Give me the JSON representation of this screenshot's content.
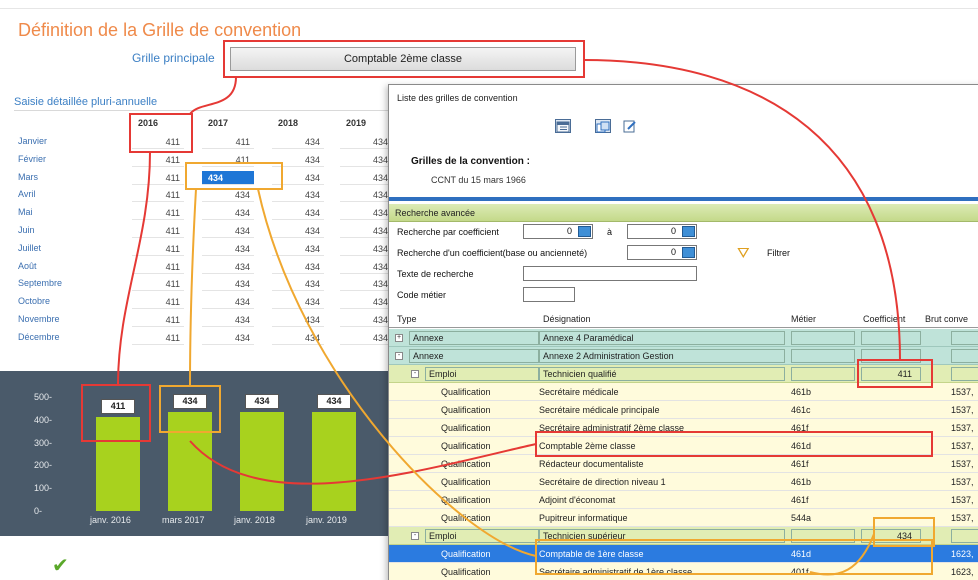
{
  "page": {
    "title": "Définition de la Grille de convention",
    "grid_label": "Grille principale",
    "grid_value": "Comptable 2ème classe",
    "saisie_label": "Saisie détaillée pluri-annuelle"
  },
  "years": [
    "2016",
    "2017",
    "2018",
    "2019"
  ],
  "months": [
    "Janvier",
    "Février",
    "Mars",
    "Avril",
    "Mai",
    "Juin",
    "Juillet",
    "Août",
    "Septembre",
    "Octobre",
    "Novembre",
    "Décembre"
  ],
  "monthly_values": [
    [
      "411",
      "411",
      "434",
      "434"
    ],
    [
      "411",
      "411",
      "434",
      "434"
    ],
    [
      "411",
      "434",
      "434",
      "434"
    ],
    [
      "411",
      "434",
      "434",
      "434"
    ],
    [
      "411",
      "434",
      "434",
      "434"
    ],
    [
      "411",
      "434",
      "434",
      "434"
    ],
    [
      "411",
      "434",
      "434",
      "434"
    ],
    [
      "411",
      "434",
      "434",
      "434"
    ],
    [
      "411",
      "434",
      "434",
      "434"
    ],
    [
      "411",
      "434",
      "434",
      "434"
    ],
    [
      "411",
      "434",
      "434",
      "434"
    ],
    [
      "411",
      "434",
      "434",
      "434"
    ]
  ],
  "selected_cell_value": "434",
  "chart_data": {
    "type": "bar",
    "categories": [
      "janv. 2016",
      "mars 2017",
      "janv. 2018",
      "janv. 2019"
    ],
    "values": [
      411,
      434,
      434,
      434
    ],
    "data_labels": [
      "411",
      "434",
      "434",
      "434"
    ],
    "y_ticks": [
      "500-",
      "400-",
      "300-",
      "200-",
      "100-",
      "0-"
    ],
    "ylim": [
      0,
      500
    ],
    "title": "",
    "xlabel": "",
    "ylabel": "",
    "bar_color": "#a8d21e",
    "background": "#4a5a6a"
  },
  "window": {
    "title": "Liste des grilles de convention",
    "toolbar_icons": [
      "calendar-icon",
      "copy-icon",
      "edit-icon"
    ],
    "grilles_title": "Grilles de la convention :",
    "grilles_value": "CCNT du 15 mars 1966",
    "search_section": "Recherche avancée",
    "search_coef_label": "Recherche par coefficient",
    "coef_from": "0",
    "a_label": "à",
    "coef_to": "0",
    "search_coef2_label": "Recherche d'un coefficient(base ou ancienneté)",
    "coef2": "0",
    "text_search_label": "Texte de recherche",
    "code_label": "Code métier",
    "filter_label": "Filtrer",
    "columns": [
      "Type",
      "Désignation",
      "Métier",
      "Coefficient",
      "Brut conve"
    ],
    "rows": [
      {
        "kind": "annexe",
        "sign": "+",
        "indent": 0,
        "type": "Annexe",
        "designation": "Annexe 4 Paramédical",
        "metier": "",
        "coef": "",
        "brut": ""
      },
      {
        "kind": "annexe",
        "sign": "-",
        "indent": 0,
        "type": "Annexe",
        "designation": "Annexe 2 Administration Gestion",
        "metier": "",
        "coef": "",
        "brut": ""
      },
      {
        "kind": "emploi",
        "sign": "-",
        "indent": 1,
        "type": "Emploi",
        "designation": "Technicien qualifié",
        "metier": "",
        "coef": "411",
        "brut": ""
      },
      {
        "kind": "qual",
        "sign": "",
        "indent": 2,
        "type": "Qualification",
        "designation": "Secrétaire médicale",
        "metier": "461b",
        "coef": "",
        "brut": "1537,"
      },
      {
        "kind": "qual",
        "sign": "",
        "indent": 2,
        "type": "Qualification",
        "designation": "Secrétaire médicale principale",
        "metier": "461c",
        "coef": "",
        "brut": "1537,"
      },
      {
        "kind": "qual",
        "sign": "",
        "indent": 2,
        "type": "Qualification",
        "designation": "Secrétaire administratif 2ème classe",
        "metier": "461f",
        "coef": "",
        "brut": "1537,"
      },
      {
        "kind": "qual",
        "sign": "",
        "indent": 2,
        "type": "Qualification",
        "designation": "Comptable 2ème classe",
        "metier": "461d",
        "coef": "",
        "brut": "1537,"
      },
      {
        "kind": "qual",
        "sign": "",
        "indent": 2,
        "type": "Qualification",
        "designation": "Rédacteur documentaliste",
        "metier": "461f",
        "coef": "",
        "brut": "1537,"
      },
      {
        "kind": "qual",
        "sign": "",
        "indent": 2,
        "type": "Qualification",
        "designation": "Secrétaire de direction niveau 1",
        "metier": "461b",
        "coef": "",
        "brut": "1537,"
      },
      {
        "kind": "qual",
        "sign": "",
        "indent": 2,
        "type": "Qualification",
        "designation": "Adjoint d'économat",
        "metier": "461f",
        "coef": "",
        "brut": "1537,"
      },
      {
        "kind": "qual",
        "sign": "",
        "indent": 2,
        "type": "Qualification",
        "designation": "Pupitreur informatique",
        "metier": "544a",
        "coef": "",
        "brut": "1537,"
      },
      {
        "kind": "emploi",
        "sign": "-",
        "indent": 1,
        "type": "Emploi",
        "designation": "Technicien supérieur",
        "metier": "",
        "coef": "434",
        "brut": ""
      },
      {
        "kind": "selected",
        "sign": "",
        "indent": 2,
        "type": "Qualification",
        "designation": "Comptable de 1ère classe",
        "metier": "461d",
        "coef": "",
        "brut": "1623,"
      },
      {
        "kind": "qual",
        "sign": "",
        "indent": 2,
        "type": "Qualification",
        "designation": "Secrétaire administratif de 1ère classe",
        "metier": "401f",
        "coef": "",
        "brut": "1623,"
      }
    ]
  },
  "colors": {
    "title": "#ef8a4a",
    "link_blue": "#3b7fc4",
    "selection_blue": "#2b7be0",
    "highlight_red": "#e53935",
    "highlight_orange": "#f0a830",
    "annexe_row": "#bfe3d9",
    "emploi_row": "#e1edb4",
    "qualification_row": "#fffbdc"
  }
}
